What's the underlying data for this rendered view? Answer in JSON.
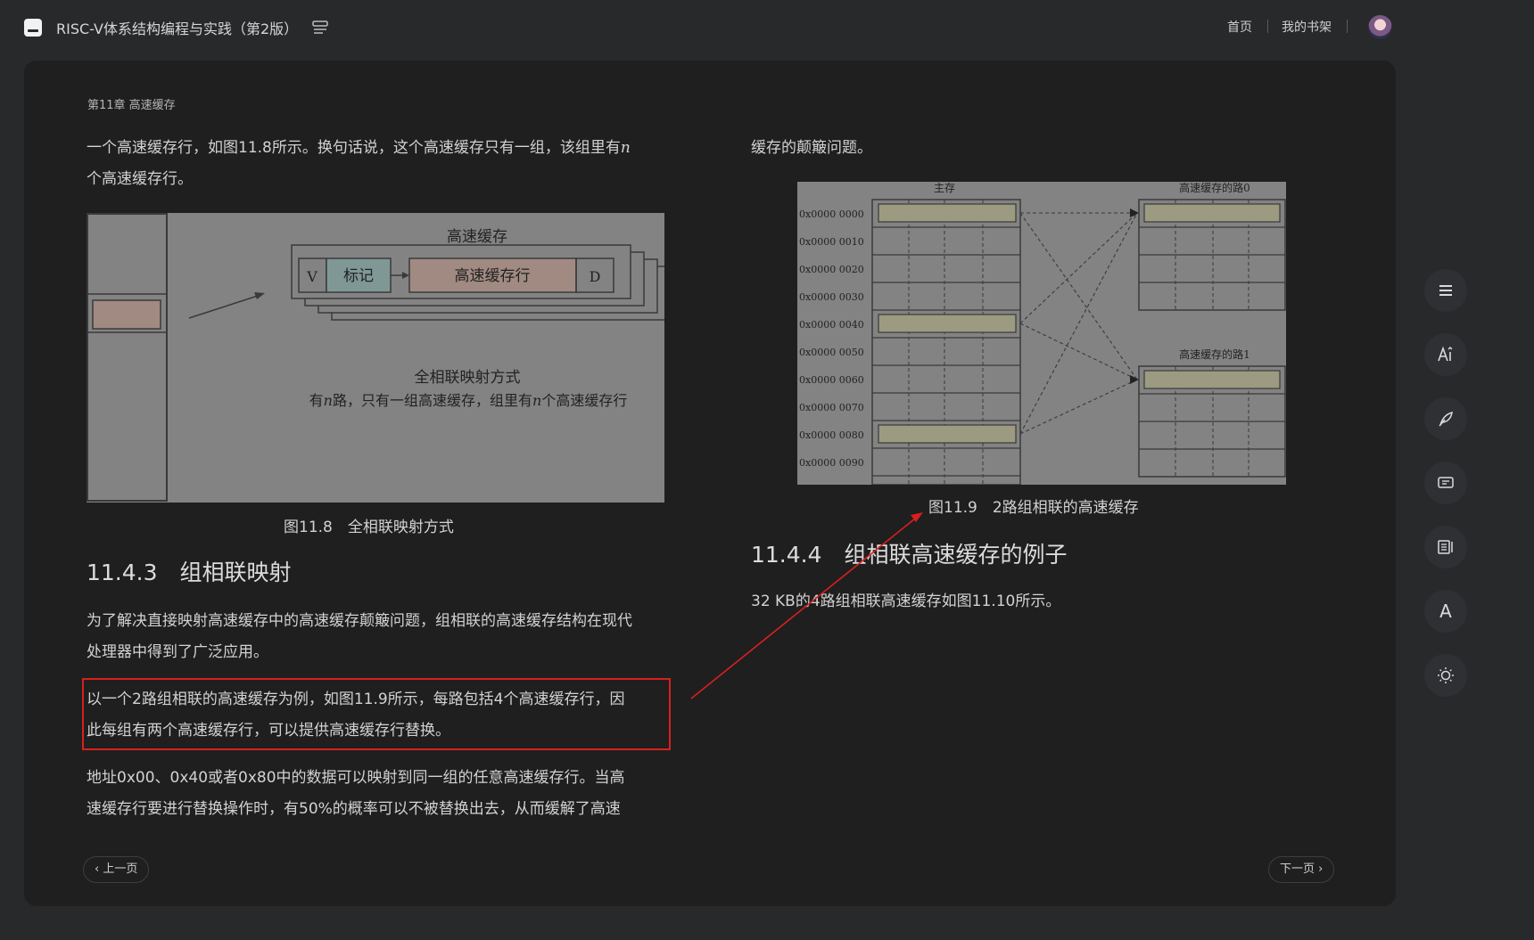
{
  "header": {
    "book_title": "RISC-V体系结构编程与实践（第2版）",
    "nav_home": "首页",
    "nav_shelf": "我的书架"
  },
  "page": {
    "chapter": "第11章 高速缓存",
    "left_top_para_line1": "一个高速缓存行，如图11.8所示。换句话说，这个高速缓存只有一组，该组里有",
    "left_top_para_var": "n",
    "left_top_para_line2": "个高速缓存行。",
    "fig118": {
      "title": "高速缓存",
      "v": "V",
      "tag": "标记",
      "line": "高速缓存行",
      "d": "D",
      "mode": "全相联映射方式",
      "desc_a": "有",
      "desc_n1": "n",
      "desc_b": "路，只有一组高速缓存，组里有",
      "desc_n2": "n",
      "desc_c": "个高速缓存行"
    },
    "fig118_caption": "图11.8　全相联映射方式",
    "section_1143": "11.4.3　组相联映射",
    "para_1_line1": "为了解决直接映射高速缓存中的高速缓存颠簸问题，组相联的高速缓存结构在现代",
    "para_1_line2": "处理器中得到了广泛应用。",
    "para_2_line1": "以一个2路组相联的高速缓存为例，如图11.9所示，每路包括4个高速缓存行，因",
    "para_2_line2": "此每组有两个高速缓存行，可以提供高速缓存行替换。",
    "para_3_line1": "地址0x00、0x40或者0x80中的数据可以映射到同一组的任意高速缓存行。当高",
    "para_3_line2": "速缓存行要进行替换操作时，有50%的概率可以不被替换出去，从而缓解了高速",
    "right_top_para": "缓存的颠簸问题。",
    "fig119": {
      "main_mem": "主存",
      "way0": "高速缓存的路0",
      "way1": "高速缓存的路1",
      "addresses": [
        "0x0000 0000",
        "0x0000 0010",
        "0x0000 0020",
        "0x0000 0030",
        "0x0000 0040",
        "0x0000 0050",
        "0x0000 0060",
        "0x0000 0070",
        "0x0000 0080",
        "0x0000 0090"
      ]
    },
    "fig119_caption": "图11.9　2路组相联的高速缓存",
    "section_1144": "11.4.4　组相联高速缓存的例子",
    "para_4": "32 KB的4路组相联高速缓存如图11.10所示。",
    "prev": "上一页",
    "next": "下一页"
  },
  "rail": {
    "font_glyph": "A"
  }
}
